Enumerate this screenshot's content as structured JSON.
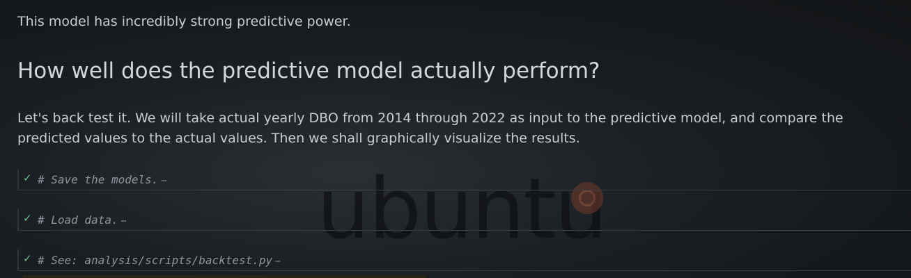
{
  "markdown": {
    "intro": "This model has incredibly strong predictive power.",
    "heading": "How well does the predictive model actually perform?",
    "body": "Let's back test it. We will take actual yearly DBO from 2014 through 2022 as input to the predictive model, and compare the predicted values to the actual values. Then we shall graphically visualize the results."
  },
  "cells": [
    {
      "status_icon": "checkmark-icon",
      "check": "✓",
      "code": "# Save the models.",
      "collapsed": "⋯"
    },
    {
      "status_icon": "checkmark-icon",
      "check": "✓",
      "code": "# Load data.",
      "collapsed": "⋯"
    },
    {
      "status_icon": "checkmark-icon",
      "check": "✓",
      "code": "# See: analysis/scripts/backtest.py",
      "collapsed": "⋯"
    }
  ],
  "desktop": {
    "wallpaper_text": "ubuntu"
  },
  "colors": {
    "success_check": "#6fbf8a",
    "text": "#c9cdd3",
    "comment": "#8e959d"
  }
}
